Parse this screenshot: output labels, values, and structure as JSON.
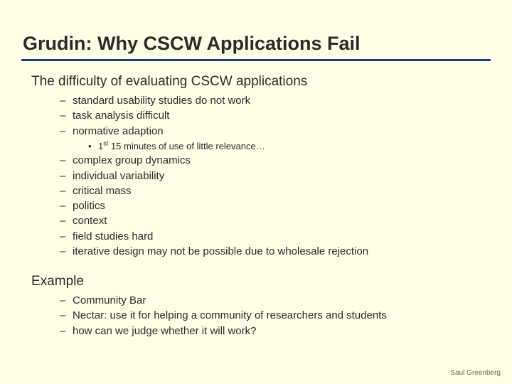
{
  "title": "Grudin: Why CSCW Applications Fail",
  "section1": {
    "heading": "The difficulty of evaluating CSCW applications",
    "groupA": [
      "standard usability studies do not work",
      "task analysis difficult",
      "normative adaption"
    ],
    "sub_prefix": "1",
    "sub_ord": "st",
    "sub_rest": " 15 minutes of use of little relevance…",
    "groupB": [
      "complex group dynamics",
      "individual variability",
      "critical mass",
      "politics",
      "context",
      "field studies hard",
      "iterative design may not be possible due to wholesale rejection"
    ]
  },
  "section2": {
    "heading": "Example",
    "items": [
      "Community Bar",
      "Nectar: use it for helping a community of researchers and students",
      "how can we judge whether it will work?"
    ]
  },
  "footer": "Saul Greenberg"
}
